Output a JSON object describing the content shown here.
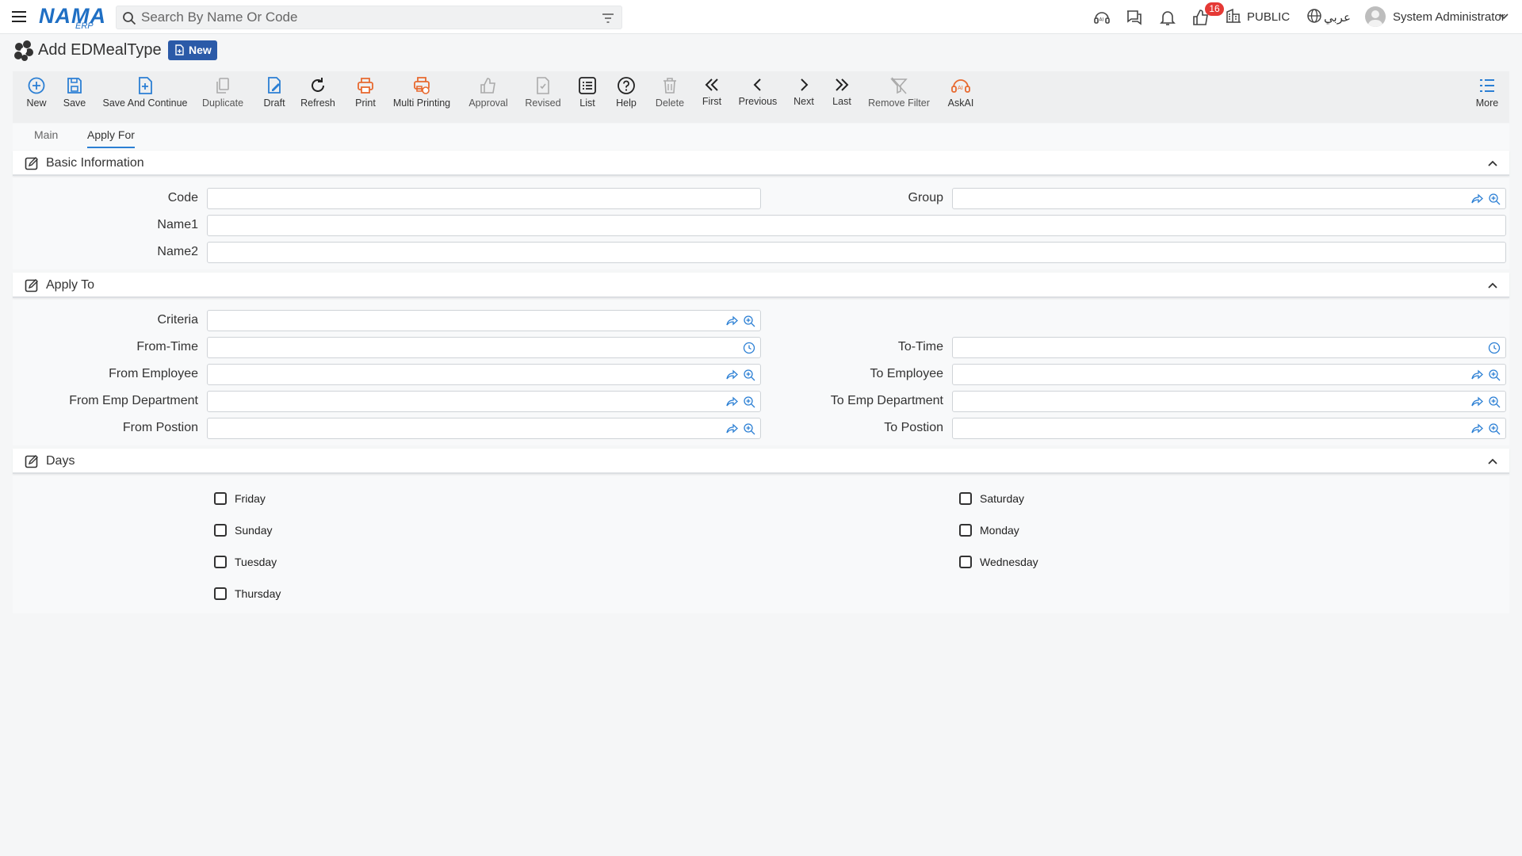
{
  "topbar": {
    "logo_main": "NAMA",
    "logo_sub": "ERP",
    "search_placeholder": "Search By Name Or Code",
    "notification_count": "16",
    "company": "PUBLIC",
    "language": "عربي",
    "user": "System Administrator"
  },
  "page": {
    "title": "Add EDMealType",
    "status": "New"
  },
  "toolbar": [
    {
      "label": "New",
      "icon": "plus-circle-icon"
    },
    {
      "label": "Save",
      "icon": "save-icon"
    },
    {
      "label": "Save And Continue",
      "icon": "save-continue-icon"
    },
    {
      "label": "Duplicate",
      "icon": "duplicate-icon"
    },
    {
      "label": "Draft",
      "icon": "draft-icon"
    },
    {
      "label": "Refresh",
      "icon": "refresh-icon"
    },
    {
      "label": "Print",
      "icon": "print-icon"
    },
    {
      "label": "Multi Printing",
      "icon": "multi-print-icon"
    },
    {
      "label": "Approval",
      "icon": "thumbs-up-icon"
    },
    {
      "label": "Revised",
      "icon": "revised-icon"
    },
    {
      "label": "List",
      "icon": "list-icon"
    },
    {
      "label": "Help",
      "icon": "help-icon"
    },
    {
      "label": "Delete",
      "icon": "trash-icon"
    },
    {
      "label": "First",
      "icon": "first-icon"
    },
    {
      "label": "Previous",
      "icon": "previous-icon"
    },
    {
      "label": "Next",
      "icon": "next-icon"
    },
    {
      "label": "Last",
      "icon": "last-icon"
    },
    {
      "label": "Remove Filter",
      "icon": "remove-filter-icon"
    },
    {
      "label": "AskAI",
      "icon": "ai-icon"
    },
    {
      "label": "More",
      "icon": "more-icon"
    }
  ],
  "tabs": [
    {
      "label": "Main",
      "active": false
    },
    {
      "label": "Apply For",
      "active": true
    }
  ],
  "sections": {
    "basic": {
      "title": "Basic Information",
      "fields": {
        "code": {
          "label": "Code",
          "value": ""
        },
        "group": {
          "label": "Group",
          "value": ""
        },
        "name1": {
          "label": "Name1",
          "value": ""
        },
        "name2": {
          "label": "Name2",
          "value": ""
        }
      }
    },
    "apply_to": {
      "title": "Apply To",
      "fields": {
        "criteria": {
          "label": "Criteria",
          "value": ""
        },
        "from_time": {
          "label": "From-Time",
          "value": ""
        },
        "to_time": {
          "label": "To-Time",
          "value": ""
        },
        "from_employee": {
          "label": "From Employee",
          "value": ""
        },
        "to_employee": {
          "label": "To Employee",
          "value": ""
        },
        "from_emp_department": {
          "label": "From Emp Department",
          "value": ""
        },
        "to_emp_department": {
          "label": "To Emp Department",
          "value": ""
        },
        "from_position": {
          "label": "From Postion",
          "value": ""
        },
        "to_position": {
          "label": "To Postion",
          "value": ""
        }
      }
    },
    "days": {
      "title": "Days",
      "items": [
        {
          "label": "Friday",
          "checked": false
        },
        {
          "label": "Saturday",
          "checked": false
        },
        {
          "label": "Sunday",
          "checked": false
        },
        {
          "label": "Monday",
          "checked": false
        },
        {
          "label": "Tuesday",
          "checked": false
        },
        {
          "label": "Wednesday",
          "checked": false
        },
        {
          "label": "Thursday",
          "checked": false
        }
      ]
    }
  },
  "colors": {
    "accent": "#1f6fc4",
    "print_orange": "#e8692f",
    "badge_red": "#e53935",
    "status_blue": "#2b5aa8"
  }
}
